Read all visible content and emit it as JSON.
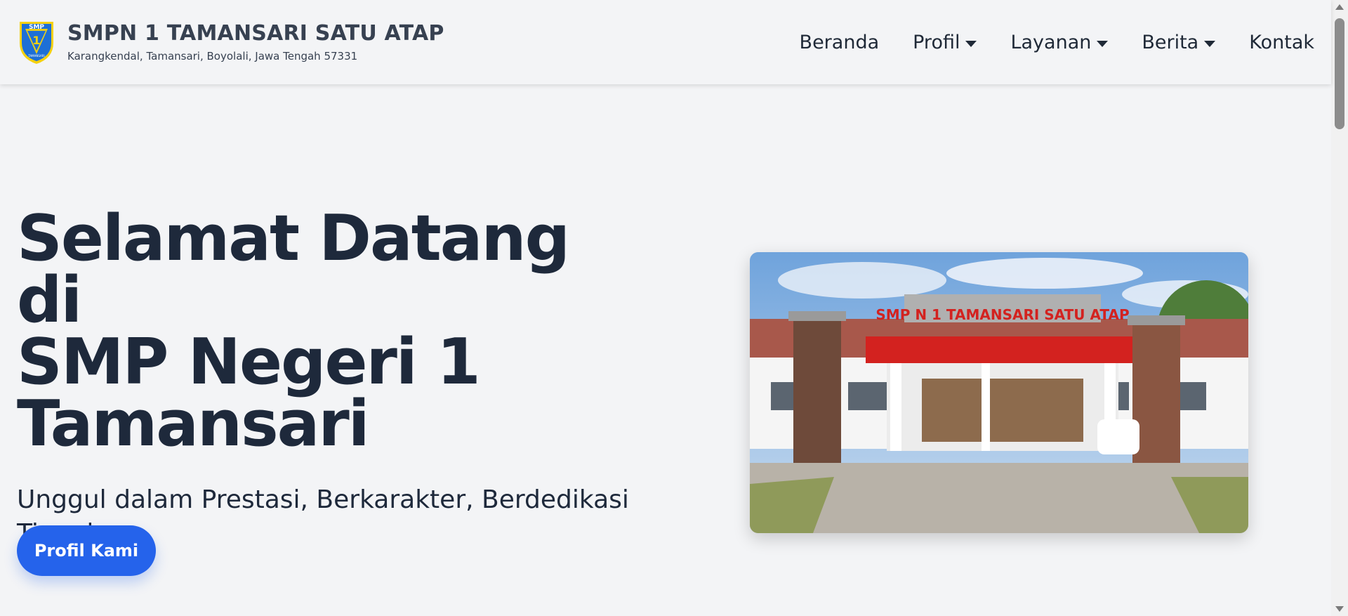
{
  "header": {
    "site_name": "SMPN 1 TAMANSARI SATU ATAP",
    "address": "Karangkendal, Tamansari, Boyolali, Jawa Tengah 57331",
    "logo": {
      "icon": "school-shield-logo",
      "text_top": "SMP",
      "text_number": "1",
      "text_bottom": "TAMANSARI"
    }
  },
  "nav": {
    "items": [
      {
        "label": "Beranda",
        "has_dropdown": false
      },
      {
        "label": "Profil",
        "has_dropdown": true
      },
      {
        "label": "Layanan",
        "has_dropdown": true
      },
      {
        "label": "Berita",
        "has_dropdown": true
      },
      {
        "label": "Kontak",
        "has_dropdown": false
      }
    ]
  },
  "hero": {
    "title_lines": [
      "Selamat Datang di",
      "SMP Negeri 1",
      "Tamansari"
    ],
    "subtitle": "Unggul dalam Prestasi, Berkarakter, Berdedikasi Tinggi",
    "cta_label": "Profil Kami",
    "image": {
      "sign_text": "SMP N 1 TAMANSARI SATU ATAP"
    }
  },
  "colors": {
    "background": "#f3f4f6",
    "primary_button": "#2563eb",
    "heading": "#1e293b",
    "logo_blue": "#1d6fd6",
    "logo_yellow": "#f5d10f"
  }
}
